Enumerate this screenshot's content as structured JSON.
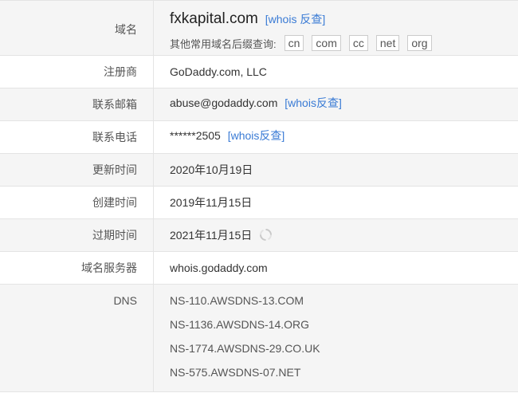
{
  "rows": [
    {
      "label": "域名",
      "value": "fxkapital.com",
      "link": "[whois 反查]"
    },
    {
      "label": "注册商",
      "value": "GoDaddy.com, LLC"
    },
    {
      "label": "联系邮箱",
      "value": "abuse@godaddy.com",
      "link": "[whois反查]"
    },
    {
      "label": "联系电话",
      "value": "******2505",
      "link": "[whois反查]"
    },
    {
      "label": "更新时间",
      "value": "2020年10月19日"
    },
    {
      "label": "创建时间",
      "value": "2019年11月15日"
    },
    {
      "label": "过期时间",
      "value": "2021年11月15日",
      "icon": "refresh-icon"
    },
    {
      "label": "域名服务器",
      "value": "whois.godaddy.com"
    },
    {
      "label": "DNS",
      "dns": [
        "NS-110.AWSDNS-13.COM",
        "NS-1136.AWSDNS-14.ORG",
        "NS-1774.AWSDNS-29.CO.UK",
        "NS-575.AWSDNS-07.NET"
      ]
    }
  ],
  "suffix": {
    "label": "其他常用域名后缀查询:",
    "items": [
      "cn",
      "com",
      "cc",
      "net",
      "org"
    ]
  },
  "colors": {
    "link": "#3a7bd5",
    "shaded": "#f5f5f5",
    "border": "#e4e4e4"
  }
}
